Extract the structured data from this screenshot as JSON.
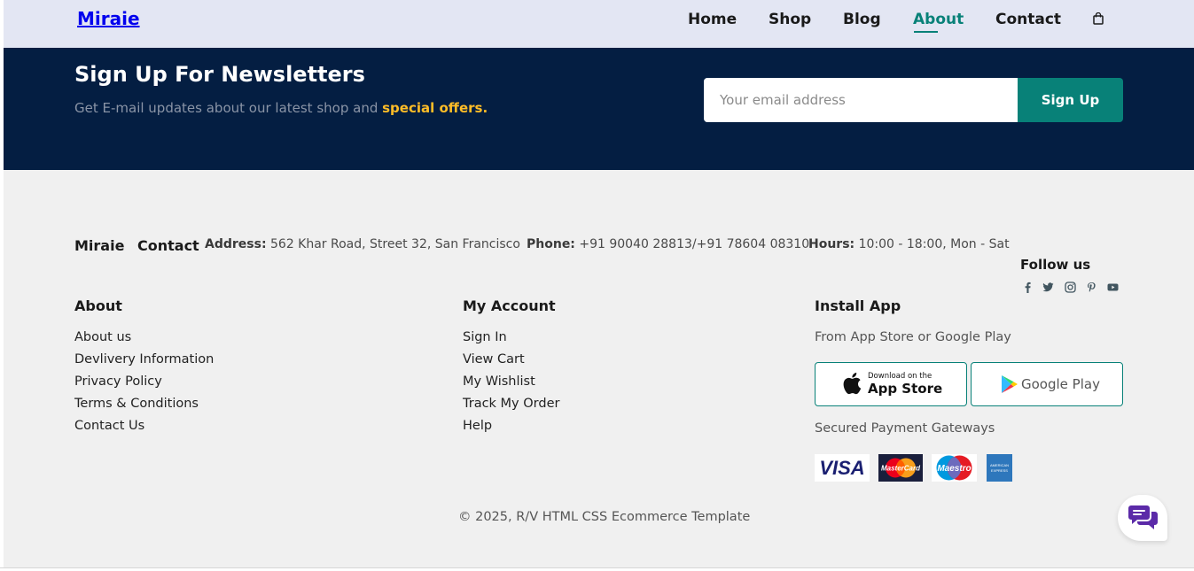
{
  "header": {
    "logo": "Miraie",
    "nav": [
      {
        "label": "Home"
      },
      {
        "label": "Shop"
      },
      {
        "label": "Blog"
      },
      {
        "label": "About",
        "active": true
      },
      {
        "label": "Contact"
      }
    ],
    "cart_icon": "shopping-bag-icon"
  },
  "newsletter": {
    "title": "Sign Up For Newsletters",
    "subtitle": "Get E-mail updates about our latest shop and",
    "subtitle_highlight": "special offers.",
    "email_placeholder": "Your email address",
    "button": "Sign Up"
  },
  "contact": {
    "brand": "Miraie",
    "heading": "Contact",
    "address_label": "Address:",
    "address": "562 Khar Road, Street 32, San Francisco",
    "phone_label": "Phone:",
    "phone": "+91 90040 28813/+91 78604 08310",
    "hours_label": "Hours:",
    "hours": "10:00 - 18:00, Mon - Sat"
  },
  "follow": {
    "title": "Follow us",
    "icons": [
      "facebook-icon",
      "twitter-icon",
      "instagram-icon",
      "pinterest-icon",
      "youtube-icon"
    ]
  },
  "about": {
    "title": "About",
    "links": [
      "About us",
      "Devlivery Information",
      "Privacy Policy",
      "Terms & Conditions",
      "Contact Us"
    ]
  },
  "account": {
    "title": "My Account",
    "links": [
      "Sign In",
      "View Cart",
      "My Wishlist",
      "Track My Order",
      "Help"
    ]
  },
  "install": {
    "title": "Install App",
    "subtitle": "From App Store or Google Play",
    "app_store_small": "Download on the",
    "app_store_big": "App Store",
    "google_play": "Google Play",
    "payments_title": "Secured Payment Gateways",
    "payments": [
      "VISA",
      "MasterCard",
      "Maestro",
      "AMERICAN EXPRESS"
    ]
  },
  "copyright": "© 2025, R/V HTML CSS Ecommerce Template",
  "colors": {
    "accent": "#088178",
    "header_bg": "#e3e6f3",
    "newsletter_bg": "#041e42",
    "highlight": "#ffbd27",
    "footer_bg": "#f0f0f0",
    "chat_icon": "#5b2aa8"
  }
}
